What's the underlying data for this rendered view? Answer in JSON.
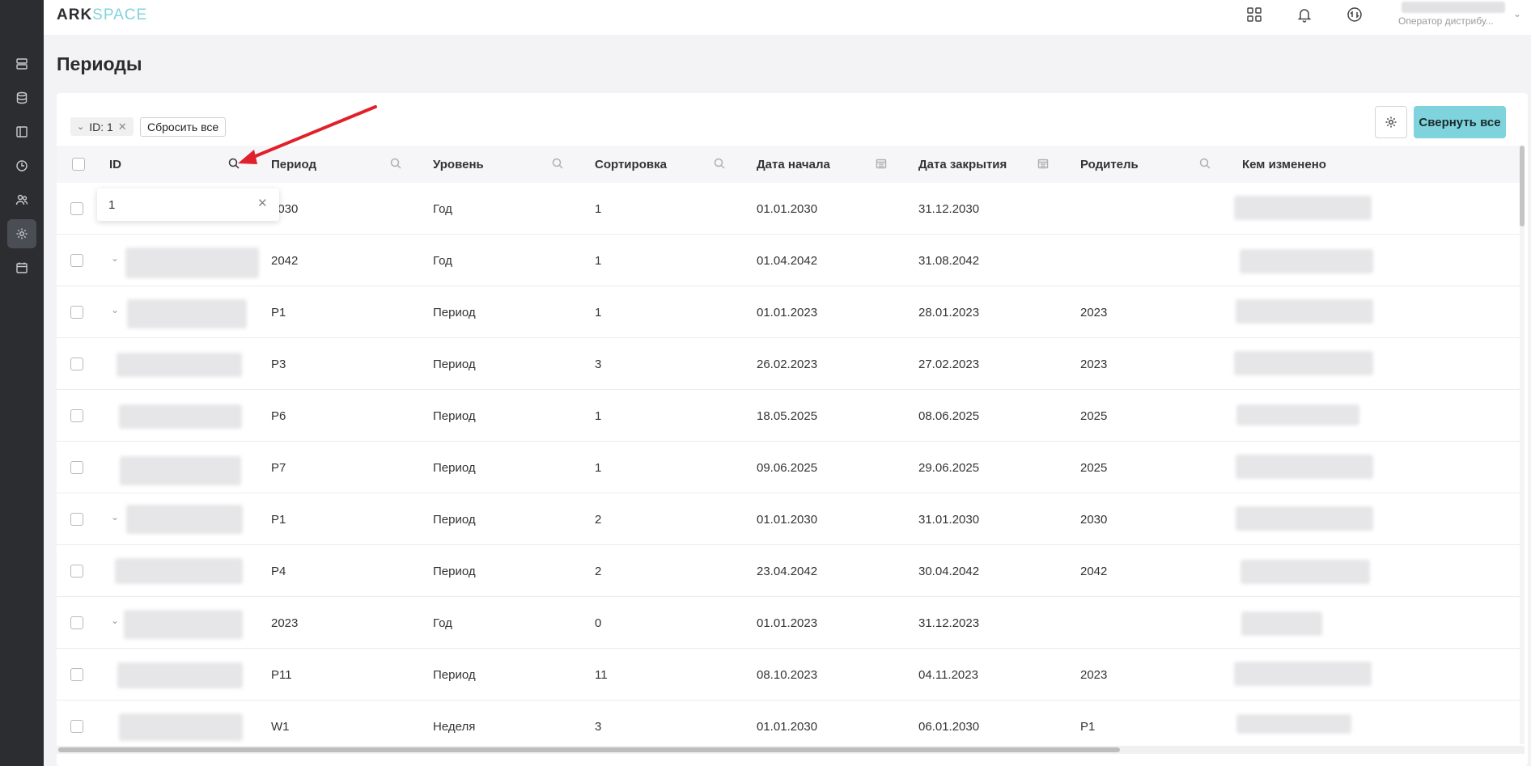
{
  "app": {
    "logo_ark": "ARK",
    "logo_space": "SPACE",
    "user_role": "Оператор дистрибу..."
  },
  "sidebar": {
    "items": [
      {
        "icon": "servers-icon"
      },
      {
        "icon": "database-icon"
      },
      {
        "icon": "book-icon"
      },
      {
        "icon": "clock-icon"
      },
      {
        "icon": "users-icon"
      },
      {
        "icon": "settings-icon",
        "active": true
      },
      {
        "icon": "calendar-icon"
      }
    ]
  },
  "topbar": {
    "icons": [
      "apps-grid-icon",
      "bell-icon",
      "sync-icon"
    ]
  },
  "page": {
    "title": "Периоды"
  },
  "filters": {
    "chip_label": "ID: 1",
    "reset_label": "Сбросить все",
    "collapse_label": "Свернуть все"
  },
  "search": {
    "value": "1"
  },
  "table": {
    "columns": [
      "ID",
      "Период",
      "Уровень",
      "Сортировка",
      "Дата начала",
      "Дата закрытия",
      "Родитель",
      "Кем изменено"
    ],
    "rows": [
      {
        "period": "2030",
        "level": "Год",
        "sort": "1",
        "start": "01.01.2030",
        "end": "31.12.2030",
        "parent": ""
      },
      {
        "period": "2042",
        "level": "Год",
        "sort": "1",
        "start": "01.04.2042",
        "end": "31.08.2042",
        "parent": ""
      },
      {
        "period": "P1",
        "level": "Период",
        "sort": "1",
        "start": "01.01.2023",
        "end": "28.01.2023",
        "parent": "2023"
      },
      {
        "period": "P3",
        "level": "Период",
        "sort": "3",
        "start": "26.02.2023",
        "end": "27.02.2023",
        "parent": "2023"
      },
      {
        "period": "P6",
        "level": "Период",
        "sort": "1",
        "start": "18.05.2025",
        "end": "08.06.2025",
        "parent": "2025"
      },
      {
        "period": "P7",
        "level": "Период",
        "sort": "1",
        "start": "09.06.2025",
        "end": "29.06.2025",
        "parent": "2025"
      },
      {
        "period": "P1",
        "level": "Период",
        "sort": "2",
        "start": "01.01.2030",
        "end": "31.01.2030",
        "parent": "2030"
      },
      {
        "period": "P4",
        "level": "Период",
        "sort": "2",
        "start": "23.04.2042",
        "end": "30.04.2042",
        "parent": "2042"
      },
      {
        "period": "2023",
        "level": "Год",
        "sort": "0",
        "start": "01.01.2023",
        "end": "31.12.2023",
        "parent": ""
      },
      {
        "period": "P11",
        "level": "Период",
        "sort": "11",
        "start": "08.10.2023",
        "end": "04.11.2023",
        "parent": "2023"
      },
      {
        "period": "W1",
        "level": "Неделя",
        "sort": "3",
        "start": "01.01.2030",
        "end": "06.01.2030",
        "parent": "P1"
      }
    ]
  },
  "colors": {
    "sidebar_bg": "#2b2d31",
    "accent": "#7ed3dc",
    "annotation_arrow": "#e0202a"
  }
}
